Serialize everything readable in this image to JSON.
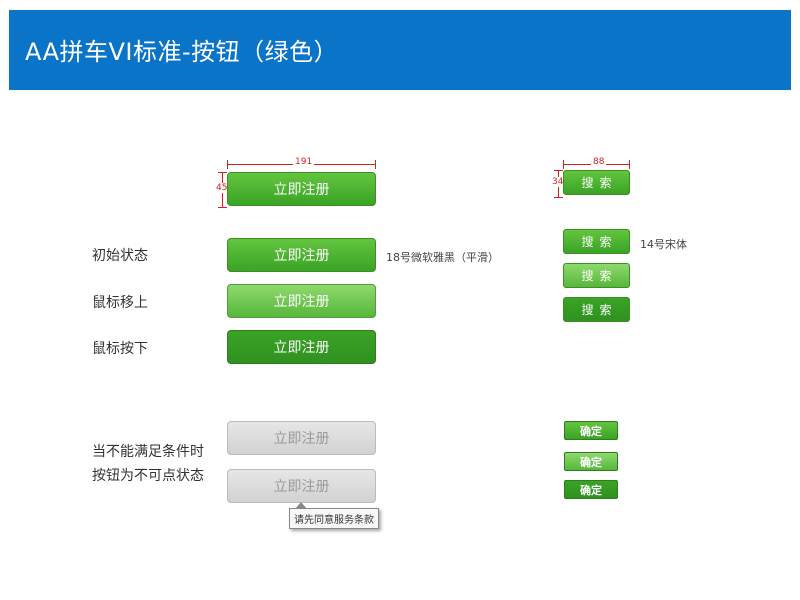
{
  "header": {
    "title": "AA拼车VI标准-按钮（绿色）"
  },
  "states": {
    "initial": "初始状态",
    "hover": "鼠标移上",
    "pressed": "鼠标按下",
    "disabled_line1": "当不能满足条件时",
    "disabled_line2": "按钮为不可点状态"
  },
  "register_button": {
    "label": "立即注册",
    "font_note": "18号微软雅黑（平滑）"
  },
  "search_button": {
    "label": "搜索",
    "font_note": "14号宋体"
  },
  "confirm_button": {
    "label": "确定"
  },
  "tooltip": {
    "text": "请先同意服务条款"
  },
  "dimensions": {
    "register_width": "191",
    "register_height": "45",
    "search_width": "88",
    "search_height": "34"
  },
  "colors": {
    "header_bg": "#0a74c9",
    "green": "#3aa325",
    "green_hover": "#8fd96e",
    "disabled": "#d2d2d2",
    "annotation_red": "#d42020"
  }
}
